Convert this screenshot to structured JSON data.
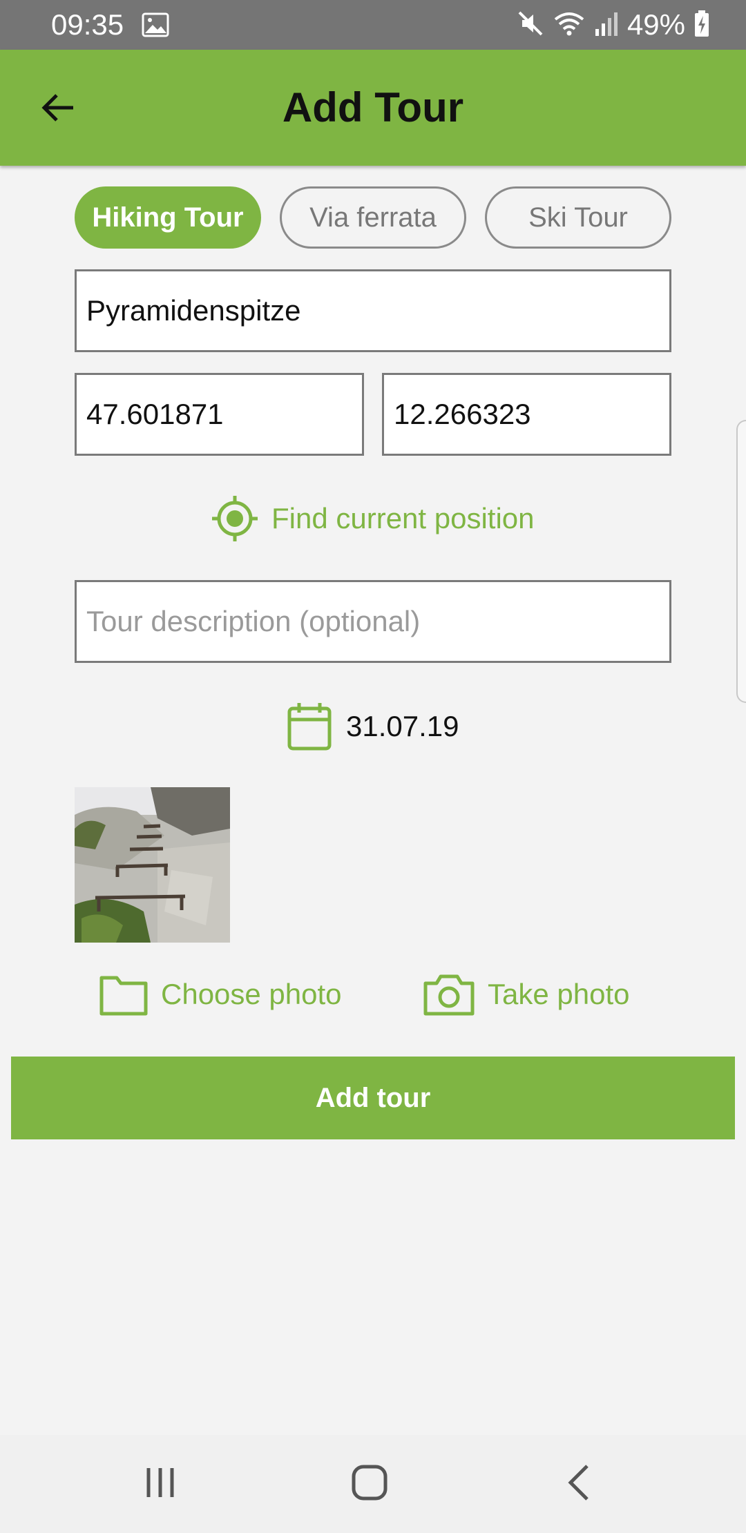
{
  "status_bar": {
    "time": "09:35",
    "battery": "49%"
  },
  "app_bar": {
    "title": "Add Tour"
  },
  "tour_types": [
    {
      "label": "Hiking Tour",
      "selected": true
    },
    {
      "label": "Via ferrata",
      "selected": false
    },
    {
      "label": "Ski Tour",
      "selected": false
    }
  ],
  "form": {
    "name_value": "Pyramidenspitze",
    "latitude_value": "47.601871",
    "longitude_value": "12.266323",
    "find_position_label": "Find current position",
    "description_placeholder": "Tour description (optional)",
    "date": "31.07.19"
  },
  "photos": {
    "choose_label": "Choose photo",
    "take_label": "Take photo"
  },
  "submit_label": "Add tour",
  "colors": {
    "accent": "#7fb543",
    "status_bar": "#757575",
    "background": "#f3f3f3"
  },
  "icons": {
    "back": "arrow-left-icon",
    "gps": "gps-target-icon",
    "calendar": "calendar-icon",
    "folder": "folder-icon",
    "camera": "camera-icon"
  }
}
